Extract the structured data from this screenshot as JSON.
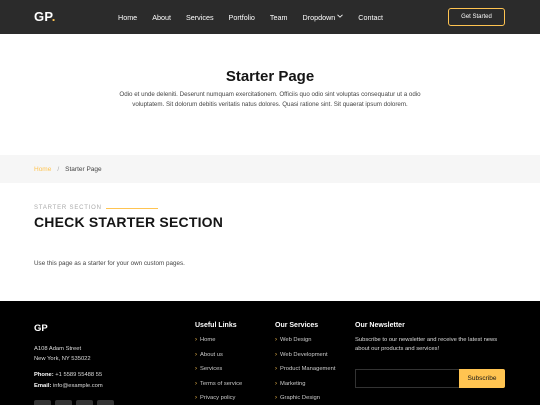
{
  "header": {
    "logo_text": "GP",
    "logo_dot": ".",
    "nav": [
      "Home",
      "About",
      "Services",
      "Portfolio",
      "Team",
      "Dropdown",
      "Contact"
    ],
    "dropdown_icon": "chevron-down-icon",
    "cta_label": "Get Started"
  },
  "page_title": {
    "title": "Starter Page",
    "description": "Odio et unde deleniti. Deserunt numquam exercitationem. Officiis quo odio sint voluptas consequatur ut a odio voluptatem. Sit dolorum debitis veritatis natus dolores. Quasi ratione sint. Sit quaerat ipsum dolorem."
  },
  "breadcrumbs": {
    "home": "Home",
    "separator": "/",
    "current": "Starter Page"
  },
  "section": {
    "subtitle": "STARTER SECTION",
    "title": "CHECK STARTER SECTION",
    "text": "Use this page as a starter for your own custom pages."
  },
  "footer": {
    "logo": "GP",
    "address_line1": "A108 Adam Street",
    "address_line2": "New York, NY 535022",
    "phone_label": "Phone:",
    "phone": " +1 5589 55488 55",
    "email_label": "Email:",
    "email": " info@example.com",
    "useful_links": {
      "heading": "Useful Links",
      "items": [
        "Home",
        "About us",
        "Services",
        "Terms of service",
        "Privacy policy"
      ]
    },
    "services": {
      "heading": "Our Services",
      "items": [
        "Web Design",
        "Web Development",
        "Product Management",
        "Marketing",
        "Graphic Design"
      ]
    },
    "newsletter": {
      "heading": "Our Newsletter",
      "text": "Subscribe to our newsletter and receive the latest news about our products and services!",
      "input_value": "",
      "button": "Subscribe"
    }
  },
  "colors": {
    "accent": "#ffc451",
    "header_bg": "#2b2b2b",
    "footer_bg": "#000000",
    "breadcrumb_bg": "#f6f6f6"
  }
}
